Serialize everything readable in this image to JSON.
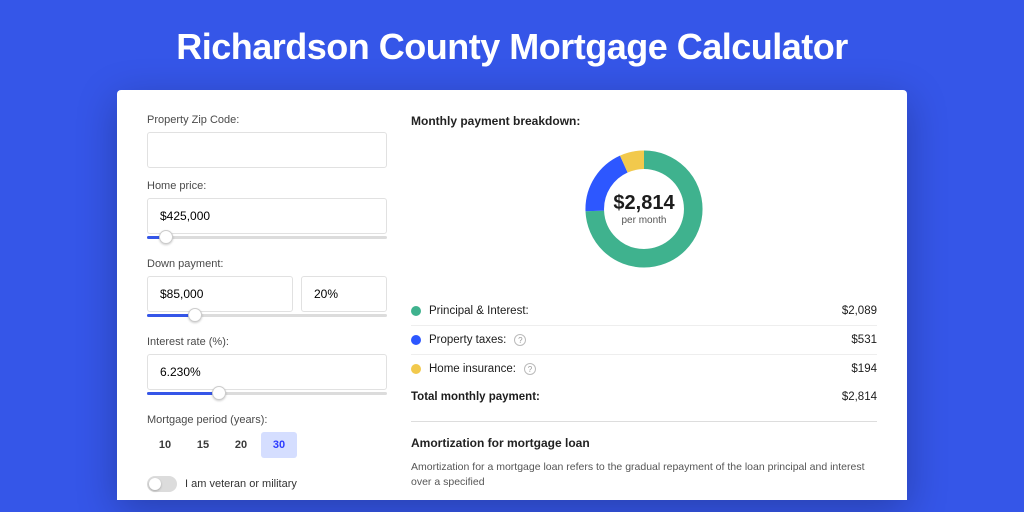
{
  "page_title": "Richardson County Mortgage Calculator",
  "form": {
    "zip_label": "Property Zip Code:",
    "zip_value": "",
    "home_price_label": "Home price:",
    "home_price_value": "$425,000",
    "home_price_slider_pct": 8,
    "down_payment_label": "Down payment:",
    "down_payment_value": "$85,000",
    "down_payment_pct_value": "20%",
    "down_payment_slider_pct": 20,
    "interest_label": "Interest rate (%):",
    "interest_value": "6.230%",
    "interest_slider_pct": 30,
    "period_label": "Mortgage period (years):",
    "period_options": [
      "10",
      "15",
      "20",
      "30"
    ],
    "period_selected_index": 3,
    "veteran_label": "I am veteran or military"
  },
  "results": {
    "heading": "Monthly payment breakdown:",
    "donut_amount": "$2,814",
    "donut_sub": "per month",
    "lines": [
      {
        "swatch": "sw-green",
        "label": "Principal & Interest:",
        "help": false,
        "value": "$2,089"
      },
      {
        "swatch": "sw-blue",
        "label": "Property taxes:",
        "help": true,
        "value": "$531"
      },
      {
        "swatch": "sw-yellow",
        "label": "Home insurance:",
        "help": true,
        "value": "$194"
      }
    ],
    "total_label": "Total monthly payment:",
    "total_value": "$2,814"
  },
  "amortization": {
    "heading": "Amortization for mortgage loan",
    "body": "Amortization for a mortgage loan refers to the gradual repayment of the loan principal and interest over a specified"
  },
  "chart_data": {
    "type": "pie",
    "title": "Monthly payment breakdown",
    "series": [
      {
        "name": "Principal & Interest",
        "value": 2089,
        "color": "#3fb28e"
      },
      {
        "name": "Property taxes",
        "value": 531,
        "color": "#2d57ff"
      },
      {
        "name": "Home insurance",
        "value": 194,
        "color": "#f2c94c"
      }
    ]
  },
  "icons": {
    "help_glyph": "?"
  }
}
